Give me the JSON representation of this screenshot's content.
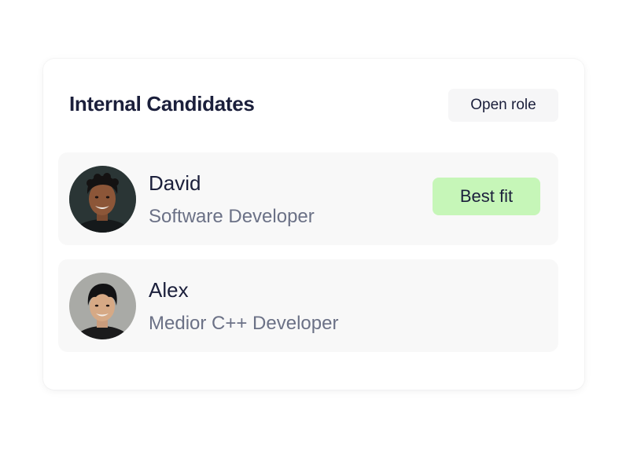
{
  "panel": {
    "title": "Internal Candidates",
    "open_role_label": "Open role"
  },
  "candidates": [
    {
      "name": "David",
      "role": "Software Developer",
      "badge": "Best fit",
      "badge_color": "#c6f6b8"
    },
    {
      "name": "Alex",
      "role": "Medior C++ Developer"
    }
  ],
  "colors": {
    "text_primary": "#1b1f3b",
    "text_secondary": "#6b7186",
    "row_background": "#f8f8f8",
    "button_background": "#f6f6f7"
  }
}
